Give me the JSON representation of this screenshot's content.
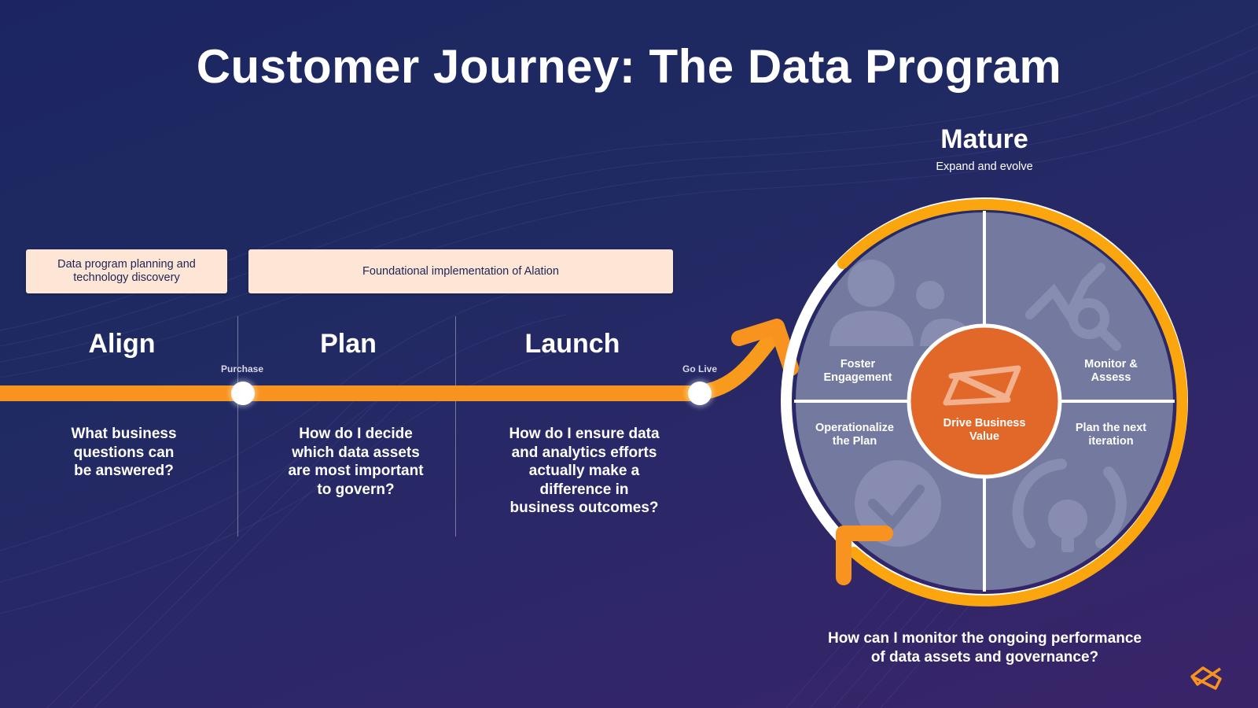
{
  "title": "Customer Journey: The Data Program",
  "callouts": [
    {
      "text": "Data program planning and technology discovery",
      "line1": "Data program planning and",
      "line2": "technology discovery"
    },
    {
      "text": "Foundational implementation of Alation"
    }
  ],
  "stages": [
    {
      "name": "Align",
      "question_lines": [
        "What business",
        "questions can",
        "be answered?"
      ]
    },
    {
      "name": "Plan",
      "question_lines": [
        "How do I decide",
        "which data assets",
        "are most important",
        "to govern?"
      ]
    },
    {
      "name": "Launch",
      "question_lines": [
        "How do I ensure data",
        "and analytics efforts",
        "actually make a",
        "difference in",
        "business outcomes?"
      ]
    }
  ],
  "milestones": [
    {
      "label": "Purchase"
    },
    {
      "label": "Go Live"
    }
  ],
  "mature": {
    "title": "Mature",
    "subtitle": "Expand and evolve",
    "center": {
      "line1": "Drive Business",
      "line2": "Value",
      "icon": "alation-bowtie-logo-icon"
    },
    "segments": [
      {
        "line1": "Foster",
        "line2": "Engagement",
        "icon": "people-icon"
      },
      {
        "line1": "Monitor &",
        "line2": "Assess",
        "icon": "chart-magnifier-icon"
      },
      {
        "line1": "Operationalize",
        "line2": "the Plan",
        "icon": "checkmark-circle-icon"
      },
      {
        "line1": "Plan the next",
        "line2": "iteration",
        "icon": "lightbulb-refresh-icon"
      }
    ],
    "question_lines": [
      "How can I monitor the ongoing performance",
      "of data assets and governance?"
    ]
  },
  "colors": {
    "accent_orange": "#f7931e",
    "ring_orange": "#fba60f",
    "center_orange": "#e2682a",
    "segment_gray": "#7479a0",
    "callout_bg": "#fde6d6",
    "text_dark": "#1f2456"
  },
  "logo": {
    "icon": "alation-logo-icon"
  }
}
